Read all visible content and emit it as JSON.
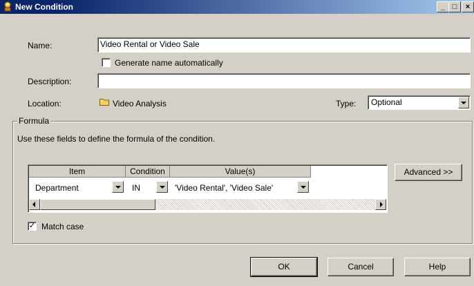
{
  "window": {
    "title": "New Condition",
    "minimize": "_",
    "maximize": "□",
    "close": "×"
  },
  "form": {
    "name_label": "Name:",
    "name_value": "Video Rental or Video Sale",
    "generate_label": "Generate name automatically",
    "generate_checked": false,
    "description_label": "Description:",
    "description_value": "",
    "location_label": "Location:",
    "location_value": "Video Analysis",
    "type_label": "Type:",
    "type_value": "Optional"
  },
  "formula": {
    "group_title": "Formula",
    "instructions": "Use these fields to define the formula of the condition.",
    "columns": [
      "Item",
      "Condition",
      "Value(s)"
    ],
    "rows": [
      {
        "item": "Department",
        "condition": "IN",
        "values": "'Video Rental', 'Video Sale'"
      }
    ],
    "advanced_label": "Advanced >>"
  },
  "match_case": {
    "label": "Match case",
    "checked": true
  },
  "buttons": {
    "ok": "OK",
    "cancel": "Cancel",
    "help": "Help"
  },
  "colors": {
    "title_start": "#0a246a",
    "title_end": "#a6caf0",
    "dialog_bg": "#d4d0c8"
  }
}
